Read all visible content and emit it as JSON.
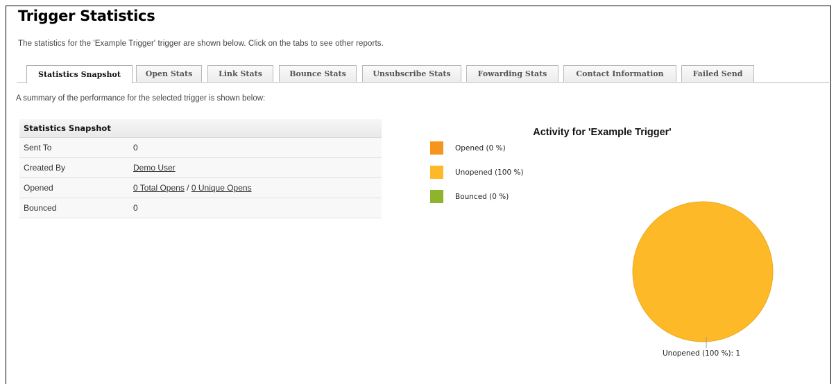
{
  "page": {
    "title": "Trigger Statistics",
    "intro": "The statistics for the 'Example Trigger' trigger are shown below. Click on the tabs to see other reports.",
    "summary": "A summary of the performance for the selected trigger is shown below:"
  },
  "tabs": [
    {
      "label": "Statistics Snapshot",
      "active": true
    },
    {
      "label": "Open Stats"
    },
    {
      "label": "Link Stats"
    },
    {
      "label": "Bounce Stats"
    },
    {
      "label": "Unsubscribe Stats"
    },
    {
      "label": "Fowarding Stats"
    },
    {
      "label": "Contact Information"
    },
    {
      "label": "Failed Send"
    }
  ],
  "snapshot": {
    "header": "Statistics Snapshot",
    "sent_to": {
      "label": "Sent To",
      "value": "0"
    },
    "created_by": {
      "label": "Created By",
      "value": "Demo User"
    },
    "opened": {
      "label": "Opened",
      "total": "0 Total Opens",
      "separator": " / ",
      "unique": "0 Unique Opens"
    },
    "bounced": {
      "label": "Bounced",
      "value": "0"
    }
  },
  "chart_data": {
    "type": "pie",
    "title": "Activity for 'Example Trigger'",
    "legend": [
      {
        "label": "Opened (0 %)",
        "color": "#f7941d"
      },
      {
        "label": "Unopened (100 %)",
        "color": "#fdb927"
      },
      {
        "label": "Bounced (0 %)",
        "color": "#8db42c"
      }
    ],
    "slices": [
      {
        "name": "Opened",
        "value": 0,
        "percent": 0,
        "color": "#f7941d"
      },
      {
        "name": "Unopened",
        "value": 1,
        "percent": 100,
        "color": "#fdb927"
      },
      {
        "name": "Bounced",
        "value": 0,
        "percent": 0,
        "color": "#8db42c"
      }
    ],
    "slice_label": "Unopened (100 %): 1"
  }
}
